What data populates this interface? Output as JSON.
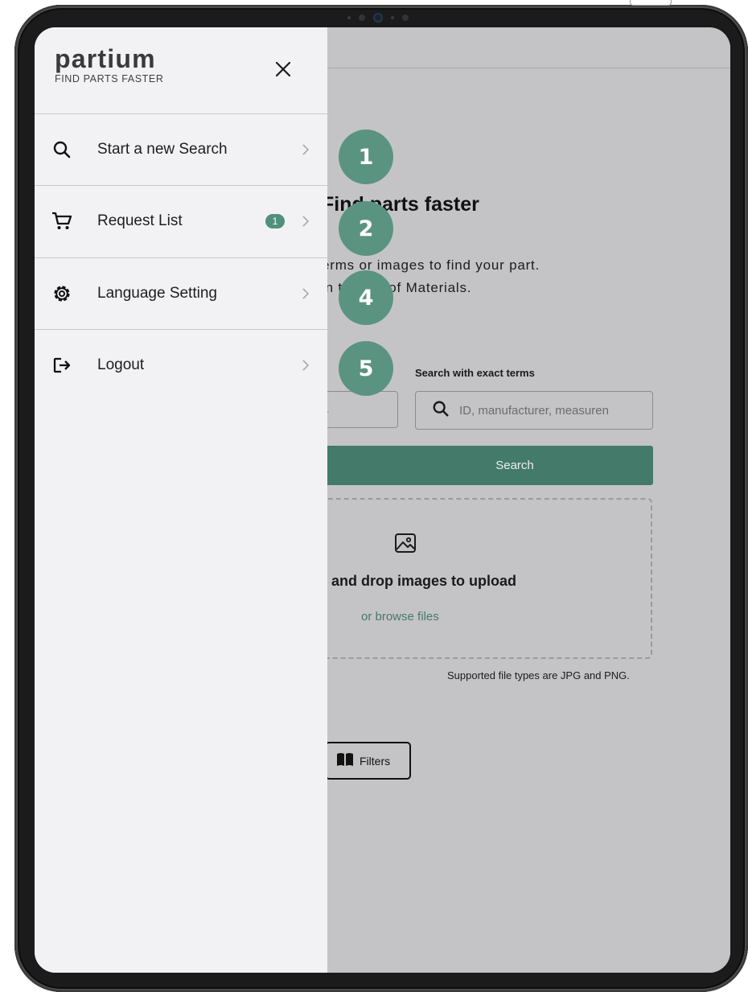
{
  "background_app": {
    "heading": "Find parts faster",
    "subtitle_line1": "erms or images to find your part.",
    "subtitle_line2": "in the Bill of Materials.",
    "exact_terms_label": "Search with exact terms",
    "left_input_value": "....",
    "search_placeholder": "ID, manufacturer, measuren",
    "search_button": "Search",
    "drop_text": "and drop images to upload",
    "browse_link": "or browse files",
    "file_types_note": "Supported file types are JPG and PNG.",
    "filters_button": "Filters"
  },
  "drawer": {
    "brand_name": "partium",
    "brand_tagline": "FIND PARTS FASTER",
    "items": [
      {
        "label": "Start a new Search",
        "icon": "search-icon"
      },
      {
        "label": "Request List",
        "icon": "cart-icon",
        "badge": "1"
      },
      {
        "label": "Language Setting",
        "icon": "gear-icon"
      },
      {
        "label": "Logout",
        "icon": "logout-icon"
      }
    ]
  },
  "callouts": [
    "1",
    "2",
    "4",
    "5"
  ],
  "colors": {
    "accent": "#447a6a",
    "callout": "#5a9480",
    "drawer_bg": "#f2f2f4",
    "overlay_bg": "#c4c4c6"
  }
}
